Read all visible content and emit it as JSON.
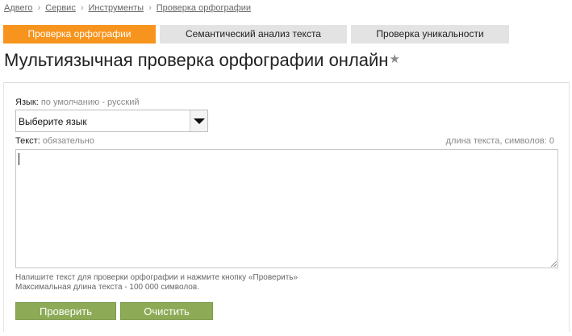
{
  "breadcrumb": {
    "items": [
      "Адвего",
      "Сервис",
      "Инструменты",
      "Проверка орфографии"
    ],
    "separator": "›"
  },
  "tabs": [
    {
      "label": "Проверка орфографии",
      "active": true
    },
    {
      "label": "Семантический анализ текста",
      "active": false
    },
    {
      "label": "Проверка уникальности",
      "active": false
    }
  ],
  "page": {
    "title": "Мультиязычная проверка орфографии онлайн",
    "star_glyph": "★"
  },
  "form": {
    "language": {
      "label": "Язык:",
      "hint": "по умолчанию - русский",
      "selected": "Выберите язык"
    },
    "text": {
      "label": "Текст:",
      "hint": "обязательно",
      "length_info": "длина текста, символов: 0",
      "value": ""
    },
    "help": {
      "line1": "Напишите текст для проверки орфографии и нажмите кнопку «Проверить»",
      "line2": "Максимальная длина текста - 100 000 символов."
    },
    "buttons": {
      "check": "Проверить",
      "clear": "Очистить"
    }
  },
  "colors": {
    "active_tab": "#f7941d",
    "inactive_tab": "#e3e3e3",
    "button": "#8dab57"
  }
}
